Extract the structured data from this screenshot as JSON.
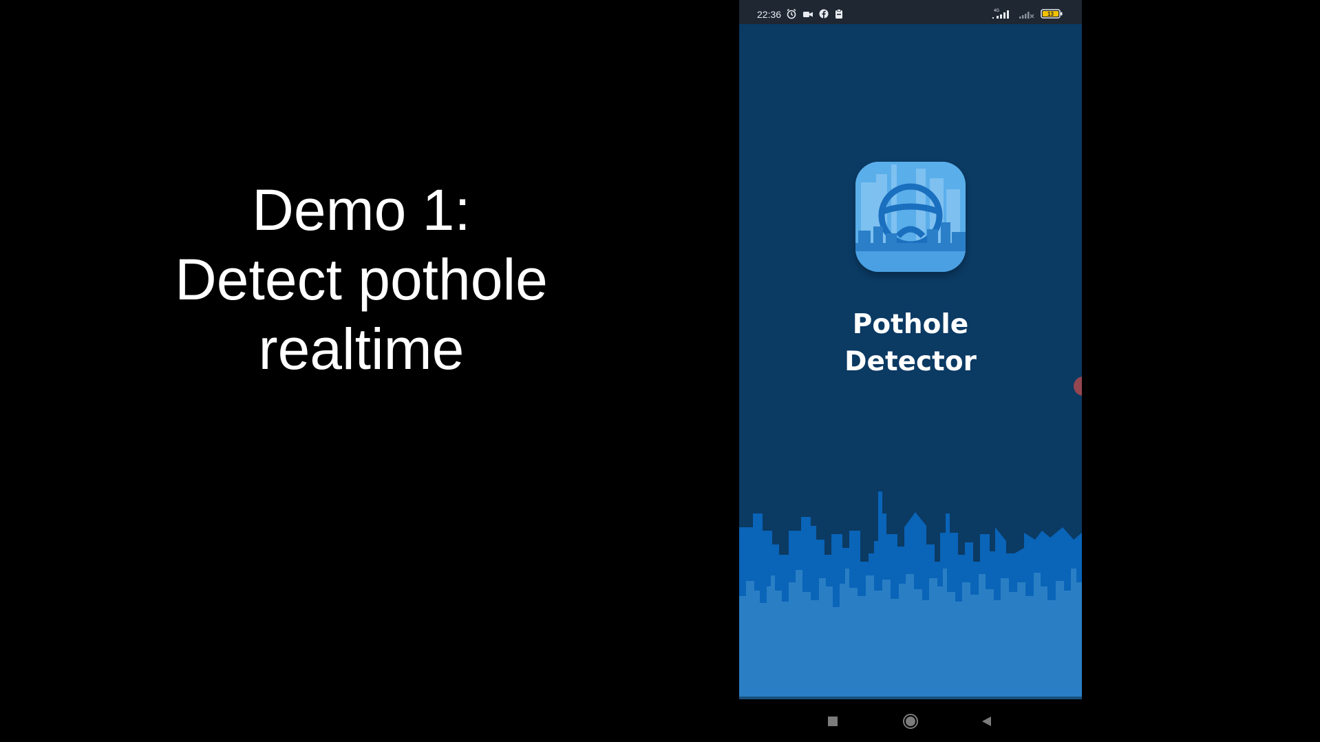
{
  "caption": {
    "line1": "Demo 1:",
    "line2": "Detect pothole",
    "line3": "realtime"
  },
  "statusbar": {
    "time": "22:36",
    "left_icons": [
      "alarm-icon",
      "video-icon",
      "facebook-icon",
      "clipboard-icon"
    ],
    "right_icons": [
      "signal-4g-icon",
      "signal-weak-icon",
      "battery-icon"
    ],
    "network_label": "4G",
    "battery_level": "13"
  },
  "app": {
    "name_line1": "Pothole",
    "name_line2": "Detector",
    "icon": "steering-wheel-city-icon"
  },
  "colors": {
    "screen_bg": "#0b3a63",
    "skyline_dark": "#0a64b8",
    "skyline_light": "#2a7fc4",
    "icon_bg": "#3a8fd6"
  },
  "navbar": {
    "buttons": [
      "recent-apps-icon",
      "home-icon",
      "back-icon"
    ]
  }
}
